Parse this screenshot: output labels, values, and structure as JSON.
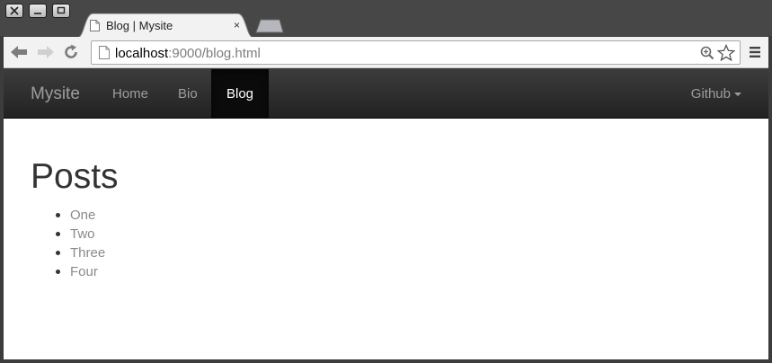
{
  "browser": {
    "tab_title": "Blog | Mysite",
    "tab_close": "×",
    "url_host": "localhost",
    "url_rest": ":9000/blog.html"
  },
  "navbar": {
    "brand": "Mysite",
    "items": [
      {
        "label": "Home",
        "active": false
      },
      {
        "label": "Bio",
        "active": false
      },
      {
        "label": "Blog",
        "active": true
      }
    ],
    "dropdown_label": "Github"
  },
  "page": {
    "heading": "Posts",
    "posts": [
      "One",
      "Two",
      "Three",
      "Four"
    ]
  },
  "colors": {
    "navbar_bg": "#222222",
    "link_muted": "#9d9d9d",
    "active_text": "#ffffff",
    "post_link": "#8a8a8a"
  }
}
